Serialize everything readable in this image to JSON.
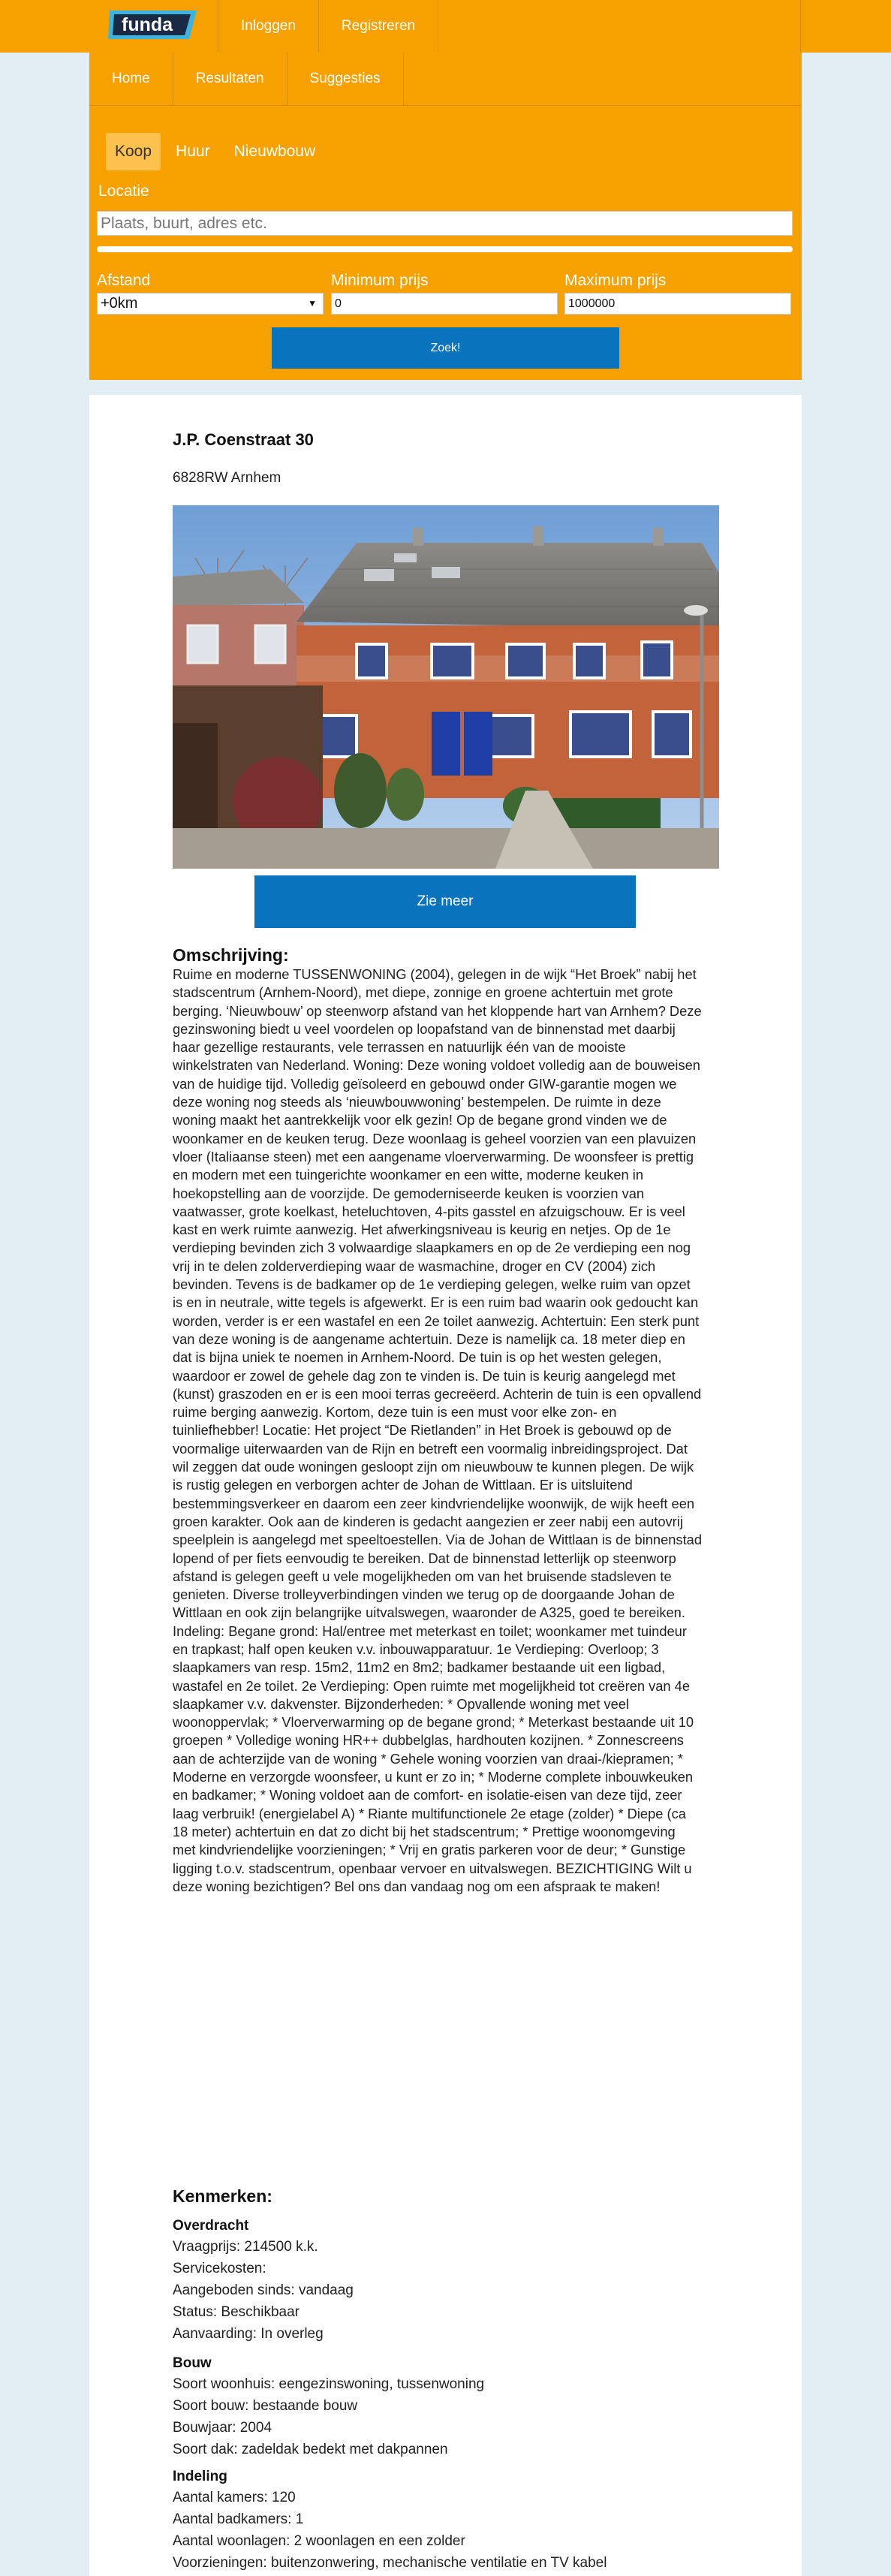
{
  "header": {
    "logo_text": "funda",
    "nav": [
      "Inloggen",
      "Registreren"
    ]
  },
  "subnav": [
    "Home",
    "Resultaten",
    "Suggesties"
  ],
  "search": {
    "type_tabs": [
      "Koop",
      "Huur",
      "Nieuwbouw"
    ],
    "active_tab": "Koop",
    "location_label": "Locatie",
    "location_placeholder": "Plaats, buurt, adres etc.",
    "distance_label": "Afstand",
    "distance_value": "+0km",
    "min_price_label": "Minimum prijs",
    "min_price_value": "0",
    "max_price_label": "Maximum prijs",
    "max_price_value": "1000000",
    "submit_label": "Zoek!"
  },
  "listing": {
    "address": "J.P. Coenstraat 30",
    "postcode_city": "6828RW Arnhem",
    "more_button": "Zie meer",
    "description_heading": "Omschrijving:",
    "description": "Ruime en moderne TUSSENWONING (2004), gelegen in de wijk “Het Broek” nabij het stadscentrum (Arnhem-Noord), met diepe, zonnige en groene achtertuin met grote berging. ‘Nieuwbouw’ op steenworp afstand van het kloppende hart van Arnhem? Deze gezinswoning biedt u veel voordelen op loopafstand van de binnenstad met daarbij haar gezellige restaurants, vele terrassen en natuurlijk één van de mooiste winkelstraten van Nederland. Woning: Deze woning voldoet volledig aan de bouweisen van de huidige tijd. Volledig geïsoleerd en gebouwd onder GIW-garantie mogen we deze woning nog steeds als ‘nieuwbouwwoning’ bestempelen. De ruimte in deze woning maakt het aantrekkelijk voor elk gezin! Op de begane grond vinden we de woonkamer en de keuken terug. Deze woonlaag is geheel voorzien van een plavuizen vloer (Italiaanse steen) met een aangename vloerverwarming. De woonsfeer is prettig en modern met een tuingerichte woonkamer en een witte, moderne keuken in hoekopstelling aan de voorzijde. De gemoderniseerde keuken is voorzien van vaatwasser, grote koelkast, heteluchtoven, 4-pits gasstel en afzuigschouw. Er is veel kast en werk ruimte aanwezig. Het afwerkingsniveau is keurig en netjes. Op de 1e verdieping bevinden zich 3 volwaardige slaapkamers en op de 2e verdieping een nog vrij in te delen zolderverdieping waar de wasmachine, droger en CV (2004) zich bevinden. Tevens is de badkamer op de 1e verdieping gelegen, welke ruim van opzet is en in neutrale, witte tegels is afgewerkt. Er is een ruim bad waarin ook gedoucht kan worden, verder is er een wastafel en een 2e toilet aanwezig. Achtertuin: Een sterk punt van deze woning is de aangename achtertuin. Deze is namelijk ca. 18 meter diep en dat is bijna uniek te noemen in Arnhem-Noord. De tuin is op het westen gelegen, waardoor er zowel de gehele dag zon te vinden is. De tuin is keurig aangelegd met (kunst) graszoden en er is een mooi terras gecreëerd. Achterin de tuin is een opvallend ruime berging aanwezig. Kortom, deze tuin is een must voor elke zon- en tuinliefhebber! Locatie: Het project “De Rietlanden” in Het Broek is gebouwd op de voormalige uiterwaarden van de Rijn en betreft een voormalig inbreidingsproject. Dat wil zeggen dat oude woningen gesloopt zijn om nieuwbouw te kunnen plegen. De wijk is rustig gelegen en verborgen achter de Johan de Wittlaan. Er is uitsluitend bestemmingsverkeer en daarom een zeer kindvriendelijke woonwijk, de wijk heeft een groen karakter. Ook aan de kinderen is gedacht aangezien er zeer nabij een autovrij speelplein is aangelegd met speeltoestellen. Via de Johan de Wittlaan is de binnenstad lopend of per fiets eenvoudig te bereiken. Dat de binnenstad letterlijk op steenworp afstand is gelegen geeft u vele mogelijkheden om van het bruisende stadsleven te genieten. Diverse trolleyverbindingen vinden we terug op de doorgaande Johan de Wittlaan en ook zijn belangrijke uitvalswegen, waaronder de A325, goed te bereiken. Indeling: Begane grond: Hal/entree met meterkast en toilet; woonkamer met tuindeur en trapkast; half open keuken v.v. inbouwapparatuur. 1e Verdieping: Overloop; 3 slaapkamers van resp. 15m2, 11m2 en 8m2; badkamer bestaande uit een ligbad, wastafel en 2e toilet. 2e Verdieping: Open ruimte met mogelijkheid tot creëren van 4e slaapkamer v.v. dakvenster. Bijzonderheden: * Opvallende woning met veel woonoppervlak; * Vloerverwarming op de begane grond; * Meterkast bestaande uit 10 groepen * Volledige woning HR++ dubbelglas, hardhouten kozijnen. * Zonnescreens aan de achterzijde van de woning * Gehele woning voorzien van draai-/kiepramen; * Moderne en verzorgde woonsfeer, u kunt er zo in; * Moderne complete inbouwkeuken en badkamer; * Woning voldoet aan de comfort- en isolatie-eisen van deze tijd, zeer laag verbruik! (energielabel A) * Riante multifunctionele 2e etage (zolder) * Diepe (ca 18 meter) achtertuin en dat zo dicht bij het stadscentrum; * Prettige woonomgeving met kindvriendelijke voorzieningen; * Vrij en gratis parkeren voor de deur; * Gunstige ligging t.o.v. stadscentrum, openbaar vervoer en uitvalswegen. BEZICHTIGING Wilt u deze woning bezichtigen? Bel ons dan vandaag nog om een afspraak te maken!",
    "features_heading": "Kenmerken:",
    "features": [
      {
        "title": "Overdracht",
        "lines": [
          "Vraagprijs: 214500 k.k.",
          "Servicekosten:",
          "Aangeboden sinds: vandaag",
          "Status: Beschikbaar",
          "Aanvaarding: In overleg"
        ]
      },
      {
        "title": "Bouw",
        "lines": [
          "Soort woonhuis: eengezinswoning, tussenwoning",
          "Soort bouw: bestaande bouw",
          "Bouwjaar: 2004",
          "Soort dak: zadeldak bedekt met dakpannen"
        ]
      },
      {
        "title": "Indeling",
        "lines": [
          "Aantal kamers: 120",
          "Aantal badkamers: 1",
          "Aantal woonlagen: 2 woonlagen en een zolder",
          "Voorzieningen: buitenzonwering, mechanische ventilatie en TV kabel"
        ]
      }
    ]
  },
  "colors": {
    "brand_orange": "#f7a100",
    "button_blue": "#0a73be",
    "page_bg": "#e3edf4"
  }
}
